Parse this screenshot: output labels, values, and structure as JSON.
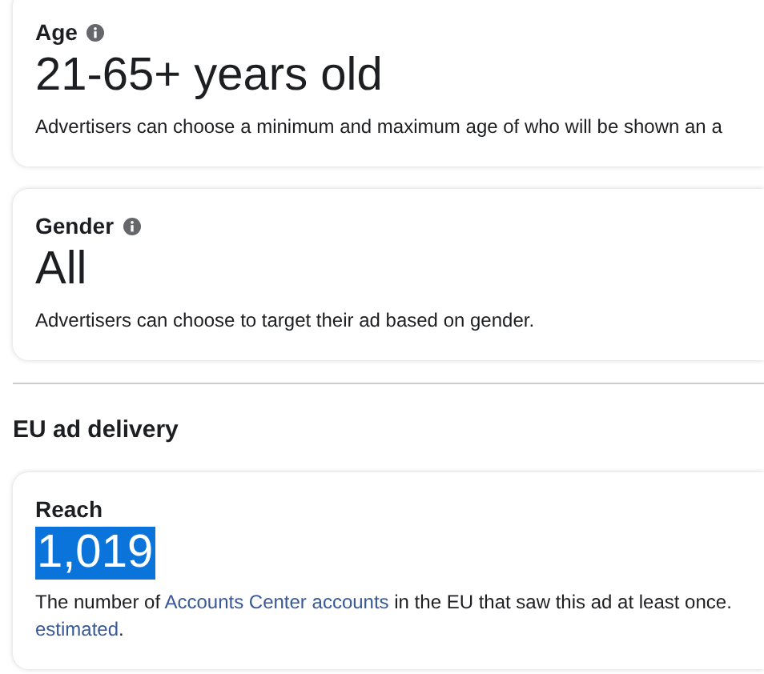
{
  "cards": [
    {
      "label": "Age",
      "info_icon": true,
      "value": "21-65+ years old",
      "highlighted": false,
      "lines": [
        [
          {
            "text": "Advertisers can choose a minimum and maximum age of who will be shown an a",
            "link": false
          }
        ]
      ]
    },
    {
      "label": "Gender",
      "info_icon": true,
      "value": "All",
      "highlighted": false,
      "lines": [
        [
          {
            "text": "Advertisers can choose to target their ad based on gender.",
            "link": false
          }
        ]
      ]
    }
  ],
  "section": {
    "title": "EU ad delivery",
    "cards": [
      {
        "label": "Reach",
        "info_icon": false,
        "value": "1,019",
        "highlighted": true,
        "lines": [
          [
            {
              "text": "The number of ",
              "link": false
            },
            {
              "text": "Accounts Center accounts",
              "link": true
            },
            {
              "text": " in the EU that saw this ad at least once.",
              "link": false
            }
          ],
          [
            {
              "text": "estimated",
              "link": true
            },
            {
              "text": ".",
              "link": false
            }
          ]
        ]
      }
    ]
  }
}
